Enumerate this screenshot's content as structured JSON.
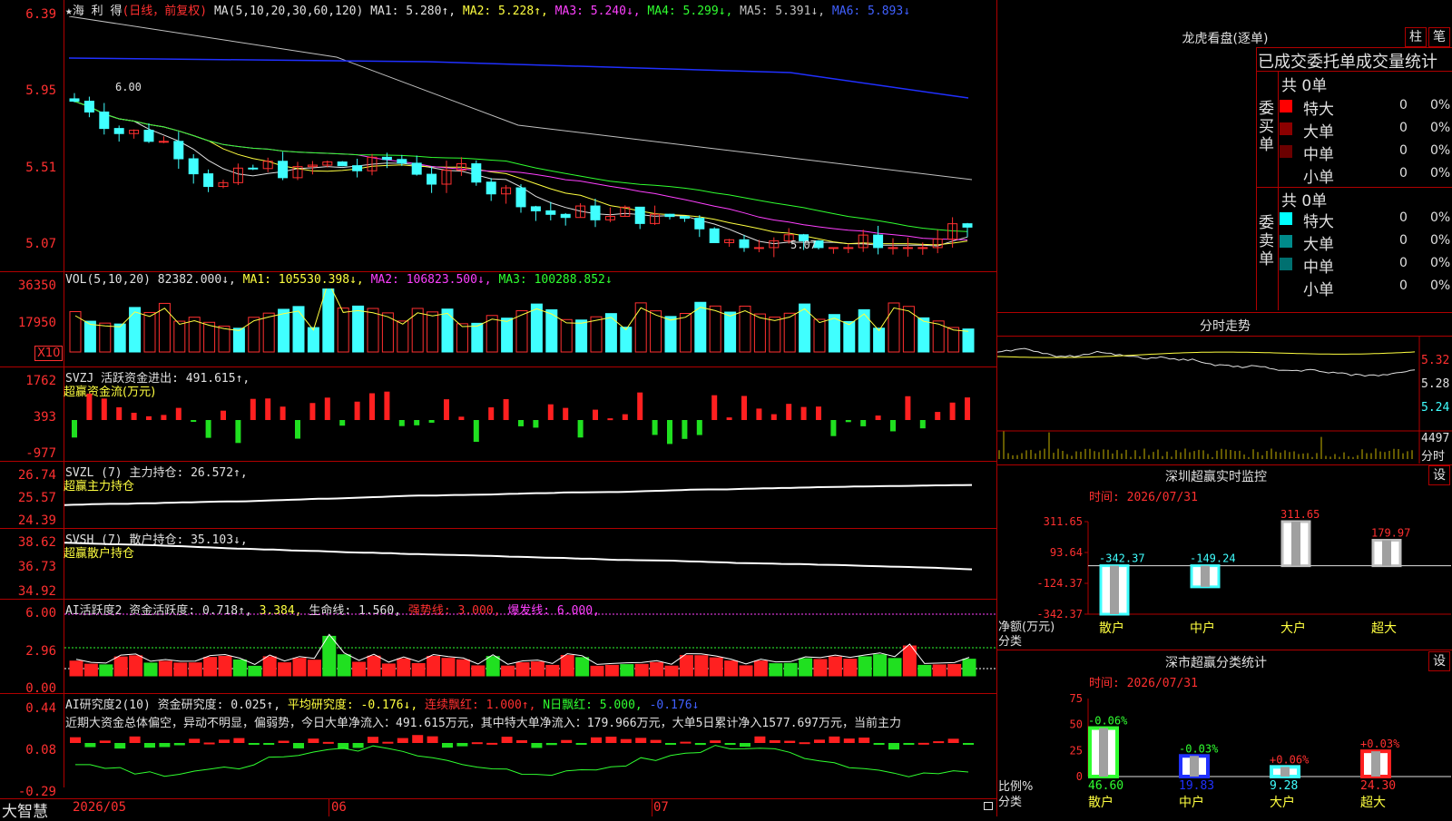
{
  "main_chart": {
    "stock_name": "★海 利 得",
    "period": "(日线，前复权)",
    "ma_def": "MA(5,10,20,30,60,120)",
    "ma1": "MA1: 5.280↑,",
    "ma2": "MA2: 5.228↑,",
    "ma3": "MA3: 5.240↓,",
    "ma4": "MA4: 5.299↓,",
    "ma5": "MA5: 5.391↓,",
    "ma6": "MA6: 5.893↓",
    "yaxis": [
      "6.39",
      "5.95",
      "5.51",
      "5.07"
    ],
    "high_label": "6.00",
    "low_label": "5.07"
  },
  "vol_panel": {
    "title": "VOL(5,10,20)",
    "value": "82382.000↓,",
    "ma1": "MA1: 105530.398↓,",
    "ma2": "MA2: 106823.500↓,",
    "ma3": "MA3: 100288.852↓",
    "yaxis": [
      "36350",
      "17950"
    ],
    "unit": "X10"
  },
  "svzj_panel": {
    "title": "SVZJ  活跃资金进出: 491.615↑,",
    "subtitle": "超赢资金流(万元)",
    "yaxis": [
      "1762",
      "393",
      "-977"
    ]
  },
  "svzl_panel": {
    "title": "SVZL (7) 主力持仓: 26.572↑,",
    "subtitle": "超赢主力持仓",
    "yaxis": [
      "26.74",
      "25.57",
      "24.39"
    ]
  },
  "svsh_panel": {
    "title": "SVSH (7) 散户持仓: 35.103↓,",
    "subtitle": "超赢散户持仓",
    "yaxis": [
      "38.62",
      "36.73",
      "34.92"
    ]
  },
  "ai_active_panel": {
    "t1": "AI活跃度2 资金活跃度: 0.718↑,",
    "t2": "3.384,",
    "t3": "生命线: 1.560,",
    "t4": "强势线: 3.000,",
    "t5": "爆发线: 6.000,",
    "yaxis": [
      "6.00",
      "2.96",
      "0.00"
    ]
  },
  "ai_research_panel": {
    "t1": "AI研究度2(10) 资金研究度: 0.025↑,",
    "t2": "平均研究度: -0.176↓,",
    "t3": "连续飘红: 1.000↑,",
    "t4": "N日飘红: 5.000,",
    "t5": "-0.176↓",
    "commentary": "近期大资金总体偏空，异动不明显，偏弱势，今日大单净流入：491.615万元，其中特大单净流入：179.966万元，大单5日累计净入1577.697万元，当前主力",
    "yaxis": [
      "0.44",
      "0.08",
      "-0.29"
    ]
  },
  "bottom_bar": {
    "brand": "大智慧",
    "dates": [
      "2026/05",
      "06",
      "07"
    ]
  },
  "right_panel": {
    "longhu_title": "龙虎看盘(逐单)",
    "btn_zhu": "柱",
    "btn_bi": "笔",
    "stat_title": "已成交委托单成交量统计",
    "buy_label": "委买单",
    "sell_label": "委卖单",
    "buy_total": "共 0单",
    "sell_total": "共 0单",
    "buy_rows": [
      {
        "label": "特大",
        "count": "0",
        "pct": "0%",
        "color": "#ff0000"
      },
      {
        "label": "大单",
        "count": "0",
        "pct": "0%",
        "color": "#8b0000"
      },
      {
        "label": "中单",
        "count": "0",
        "pct": "0%",
        "color": "#6b0000"
      },
      {
        "label": "小单",
        "count": "0",
        "pct": "0%",
        "color": ""
      }
    ],
    "sell_rows": [
      {
        "label": "特大",
        "count": "0",
        "pct": "0%",
        "color": "#00ffff"
      },
      {
        "label": "大单",
        "count": "0",
        "pct": "0%",
        "color": "#008b8b"
      },
      {
        "label": "中单",
        "count": "0",
        "pct": "0%",
        "color": "#007070"
      },
      {
        "label": "小单",
        "count": "0",
        "pct": "0%",
        "color": ""
      }
    ],
    "intraday_title": "分时走势",
    "intraday_yaxis": [
      "5.32",
      "5.28",
      "5.24"
    ],
    "intraday_vol": "4497",
    "intraday_vol_unit": "分时",
    "monitor_title": "深圳超赢实时监控",
    "monitor_time": "时间: 2026/07/31",
    "monitor_btn": "设",
    "monitor_yaxis": [
      "311.65",
      "93.64",
      "-124.37",
      "-342.37"
    ],
    "monitor_ylabel": "净额(万元)",
    "monitor_xlabel": "分类",
    "stat2_title": "深市超赢分类统计",
    "stat2_time": "时间: 2026/07/31",
    "stat2_btn": "设",
    "stat2_yaxis": [
      "75",
      "50",
      "25",
      "0"
    ],
    "stat2_ylabel": "比例%",
    "stat2_xlabel": "分类"
  },
  "chart_data": [
    {
      "type": "bar",
      "title": "深圳超赢实时监控",
      "categories": [
        "散户",
        "中户",
        "大户",
        "超大"
      ],
      "values": [
        -342.37,
        -149.24,
        311.65,
        179.97
      ],
      "ylabel": "净额(万元)",
      "ylim": [
        -342.37,
        311.65
      ]
    },
    {
      "type": "bar",
      "title": "深市超赢分类统计",
      "categories": [
        "散户",
        "中户",
        "大户",
        "超大"
      ],
      "values": [
        46.6,
        19.83,
        9.28,
        24.3
      ],
      "changes": [
        "-0.06%",
        "-0.03%",
        "+0.06%",
        "+0.03%"
      ],
      "ylabel": "比例%",
      "ylim": [
        0,
        75
      ]
    }
  ],
  "colors": {
    "up": "#ff3030",
    "down": "#40ffff",
    "grid": "#b00000"
  }
}
